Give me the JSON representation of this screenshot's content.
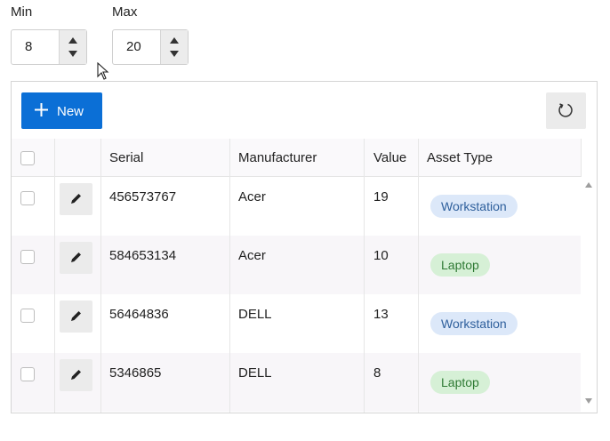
{
  "filters": {
    "min": {
      "label": "Min",
      "value": "8"
    },
    "max": {
      "label": "Max",
      "value": "20"
    }
  },
  "toolbar": {
    "new_label": "New",
    "icons": [
      "plus-icon",
      "refresh-icon"
    ]
  },
  "columns": [
    "Serial",
    "Manufacturer",
    "Value",
    "Asset Type"
  ],
  "rows": [
    {
      "serial": "456573767",
      "manufacturer": "Acer",
      "value": "19",
      "asset_type": "Workstation"
    },
    {
      "serial": "584653134",
      "manufacturer": "Acer",
      "value": "10",
      "asset_type": "Laptop"
    },
    {
      "serial": "56464836",
      "manufacturer": "DELL",
      "value": "13",
      "asset_type": "Workstation"
    },
    {
      "serial": "5346865",
      "manufacturer": "DELL",
      "value": "8",
      "asset_type": "Laptop"
    }
  ],
  "badge_colors": {
    "Workstation": {
      "bg": "#dce8f9",
      "fg": "#2e5f9c"
    },
    "Laptop": {
      "bg": "#d6f0d6",
      "fg": "#2f7a34"
    }
  },
  "colors": {
    "accent": "#0b6fd6"
  }
}
